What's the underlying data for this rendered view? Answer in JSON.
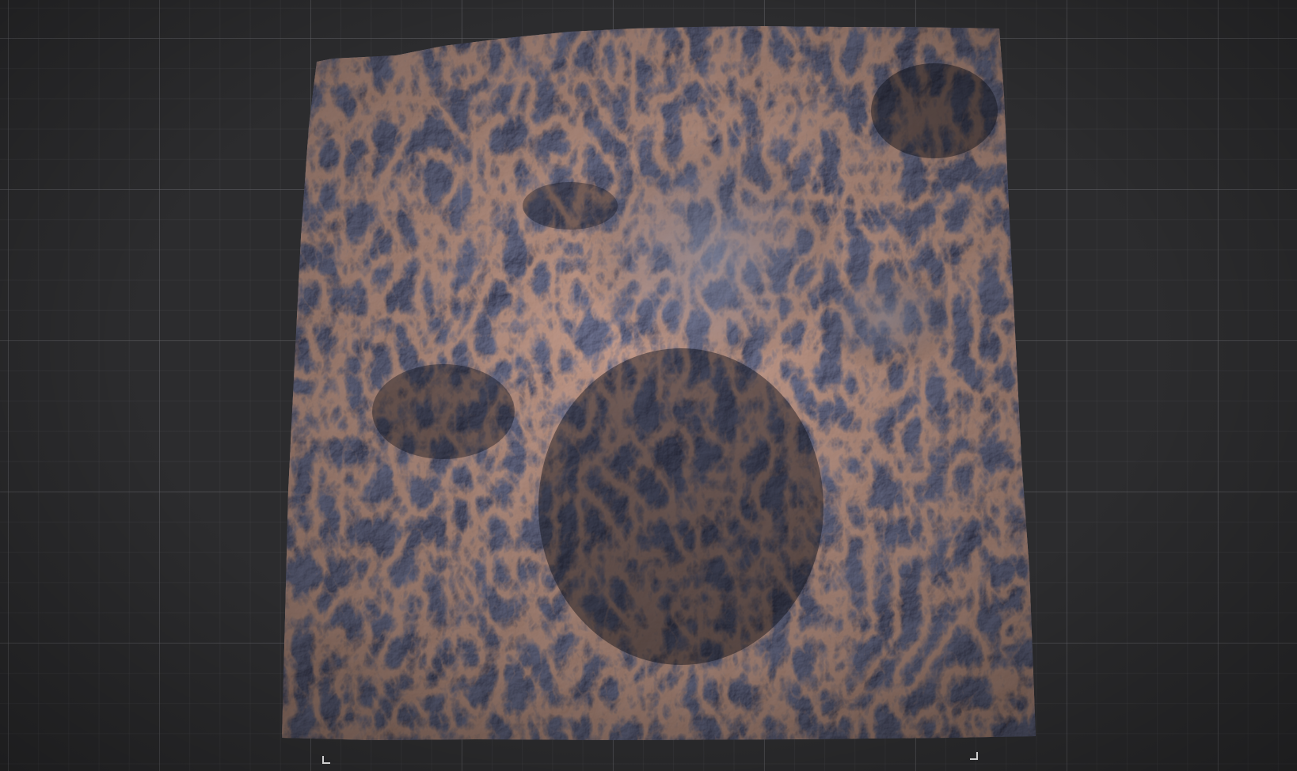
{
  "viewport": {
    "background_color": "#2c2c2e",
    "grid_color": "#6e6e73",
    "terrain_base_color": "#3a3d4c",
    "terrain_accent_color": "#c0704a"
  },
  "icons": {
    "left_corner_marker": "corner-marker-icon",
    "right_corner_marker": "corner-marker-icon"
  }
}
